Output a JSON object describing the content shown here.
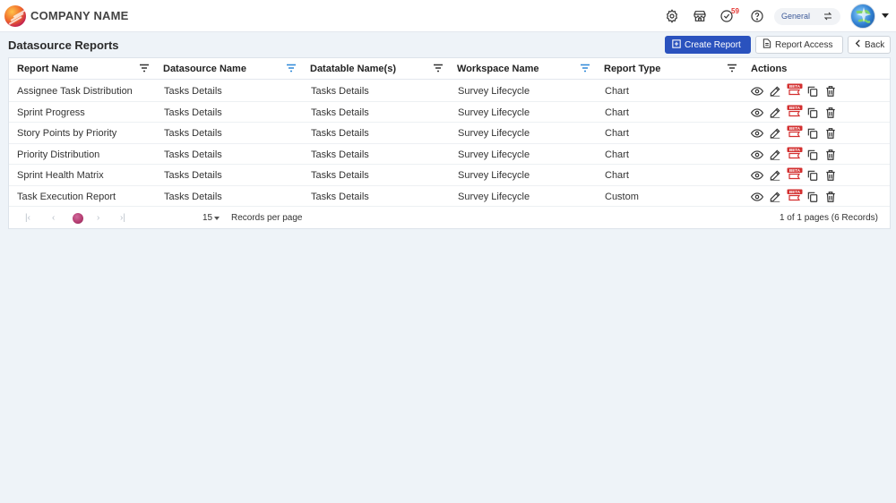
{
  "topbar": {
    "brand": "COMPANY NAME",
    "icons": [
      "settings-gear-icon",
      "store-icon",
      "tasks-check-icon",
      "help-icon"
    ],
    "notification_count": "59",
    "workspace_label": "General",
    "workspace_swap_icon": "swap-icon",
    "avatar_icon": "globe-avatar-icon"
  },
  "page": {
    "title": "Datasource Reports",
    "create_label": "Create Report",
    "access_label": "Report Access",
    "back_label": "Back"
  },
  "table": {
    "headers": [
      "Report Name",
      "Datasource Name",
      "Datatable Name(s)",
      "Workspace Name",
      "Report Type",
      "Actions"
    ],
    "rows": [
      [
        "Assignee Task Distribution",
        "Tasks Details",
        "Tasks Details",
        "Survey Lifecycle",
        "Chart"
      ],
      [
        "Sprint Progress",
        "Tasks Details",
        "Tasks Details",
        "Survey Lifecycle",
        "Chart"
      ],
      [
        "Story Points by Priority",
        "Tasks Details",
        "Tasks Details",
        "Survey Lifecycle",
        "Chart"
      ],
      [
        "Priority Distribution",
        "Tasks Details",
        "Tasks Details",
        "Survey Lifecycle",
        "Chart"
      ],
      [
        "Sprint Health Matrix",
        "Tasks Details",
        "Tasks Details",
        "Survey Lifecycle",
        "Chart"
      ],
      [
        "Task Execution Report",
        "Tasks Details",
        "Tasks Details",
        "Survey Lifecycle",
        "Custom"
      ]
    ],
    "beta_label": "BETA",
    "action_icons": [
      "view-eye-icon",
      "edit-icon",
      "beta-schedule-icon",
      "copy-icon",
      "delete-trash-icon"
    ]
  },
  "pager": {
    "per_page": "15",
    "per_page_label": "Records per page",
    "pages_info": "1 of 1 pages (6 Records)"
  },
  "colors": {
    "primary": "#2a52be",
    "filter_active": "#2f88d8",
    "beta_red": "#d32f2f",
    "page_bg": "#eef3f8"
  }
}
